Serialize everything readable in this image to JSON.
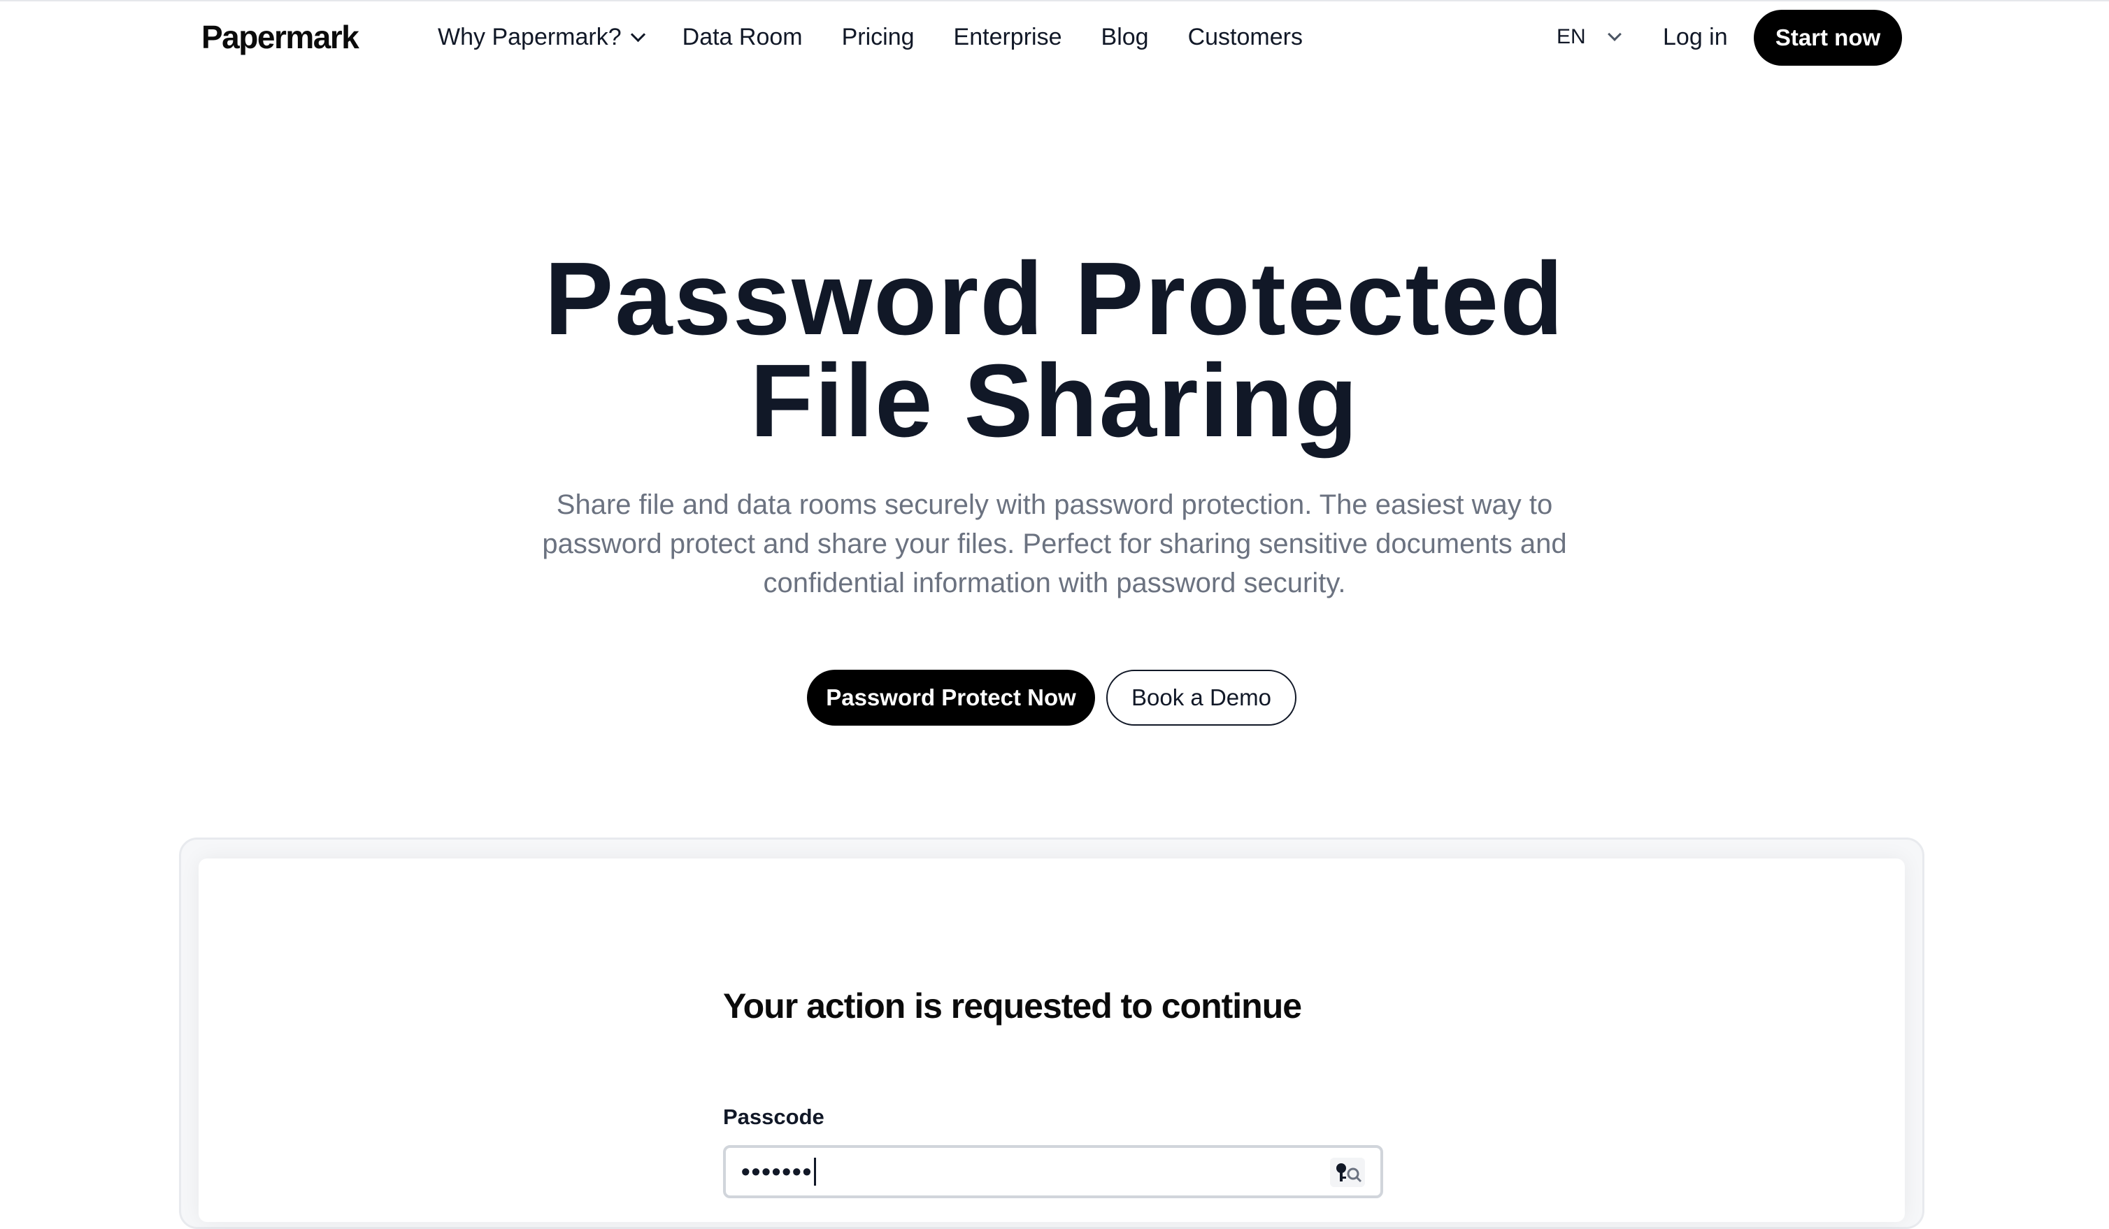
{
  "nav": {
    "logo": "Papermark",
    "links": [
      {
        "label": "Why Papermark?"
      },
      {
        "label": "Data Room"
      },
      {
        "label": "Pricing"
      },
      {
        "label": "Enterprise"
      },
      {
        "label": "Blog"
      },
      {
        "label": "Customers"
      }
    ],
    "language": "EN",
    "login": "Log in",
    "start": "Start now"
  },
  "hero": {
    "title_line1": "Password Protected",
    "title_line2": "File Sharing",
    "subtitle": "Share file and data rooms securely with password protection. The easiest way to password protect and share your files. Perfect for sharing sensitive documents and confidential information with password security.",
    "primary_cta": "Password Protect Now",
    "secondary_cta": "Book a Demo"
  },
  "preview": {
    "title": "Your action is requested to continue",
    "field_label": "Passcode",
    "field_value": "•••••••",
    "field_icon": "password-key-icon"
  }
}
